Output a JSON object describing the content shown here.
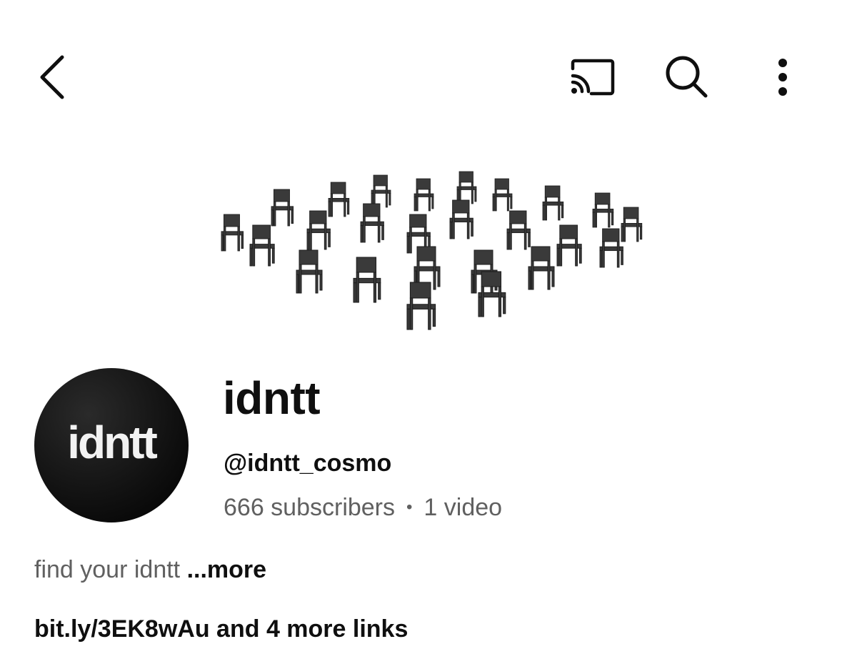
{
  "header": {
    "icons": [
      "back-icon",
      "cast-icon",
      "search-icon",
      "more-vert-icon"
    ]
  },
  "channel": {
    "name": "idntt",
    "avatar_text": "idntt",
    "handle": "@idntt_cosmo",
    "subscribers": "666 subscribers",
    "separator": "•",
    "videos": "1 video"
  },
  "about": {
    "description": "find your idntt",
    "more_label": "...more",
    "links_label": "bit.ly/3EK8wAu and 4 more links"
  },
  "colors": {
    "text_primary": "#0f0f0f",
    "text_secondary": "#606060",
    "background": "#ffffff",
    "avatar_bg": "#000000"
  }
}
